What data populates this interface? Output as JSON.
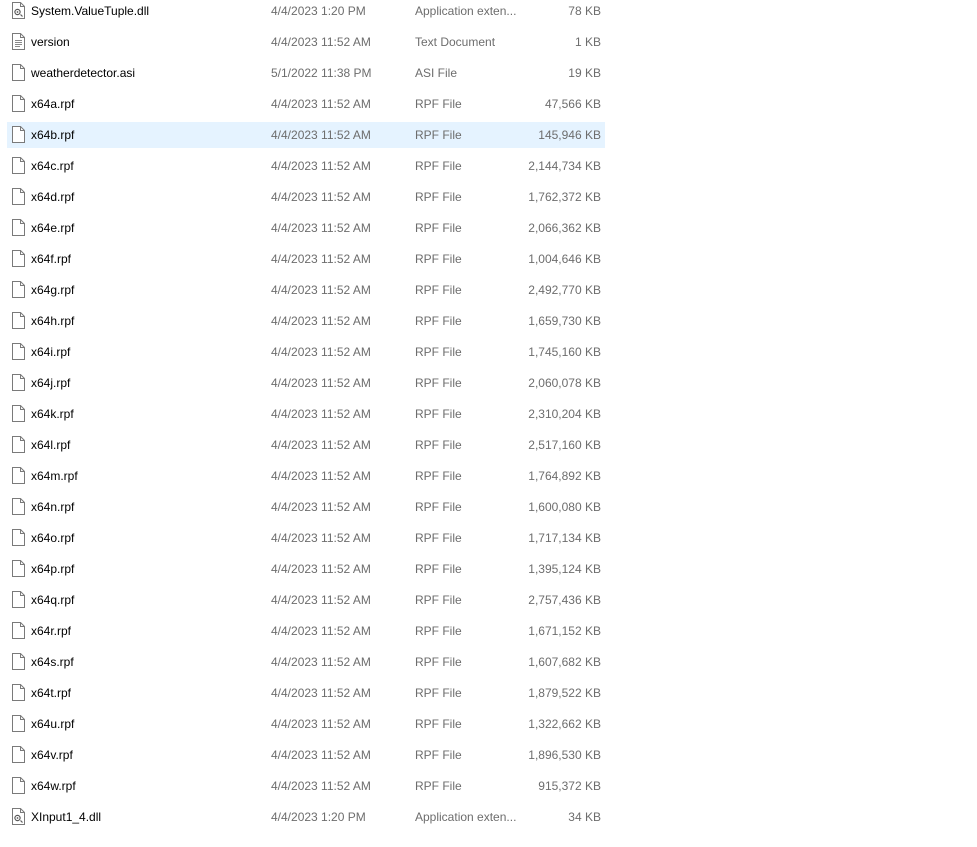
{
  "files": [
    {
      "name": "System.ValueTuple.dll",
      "date": "4/4/2023 1:20 PM",
      "type": "Application exten...",
      "size": "78 KB",
      "icon": "dll-file-icon",
      "selected": false
    },
    {
      "name": "version",
      "date": "4/4/2023 11:52 AM",
      "type": "Text Document",
      "size": "1 KB",
      "icon": "text-file-icon",
      "selected": false
    },
    {
      "name": "weatherdetector.asi",
      "date": "5/1/2022 11:38 PM",
      "type": "ASI File",
      "size": "19 KB",
      "icon": "file-icon",
      "selected": false
    },
    {
      "name": "x64a.rpf",
      "date": "4/4/2023 11:52 AM",
      "type": "RPF File",
      "size": "47,566 KB",
      "icon": "file-icon",
      "selected": false
    },
    {
      "name": "x64b.rpf",
      "date": "4/4/2023 11:52 AM",
      "type": "RPF File",
      "size": "145,946 KB",
      "icon": "file-icon",
      "selected": true
    },
    {
      "name": "x64c.rpf",
      "date": "4/4/2023 11:52 AM",
      "type": "RPF File",
      "size": "2,144,734 KB",
      "icon": "file-icon",
      "selected": false
    },
    {
      "name": "x64d.rpf",
      "date": "4/4/2023 11:52 AM",
      "type": "RPF File",
      "size": "1,762,372 KB",
      "icon": "file-icon",
      "selected": false
    },
    {
      "name": "x64e.rpf",
      "date": "4/4/2023 11:52 AM",
      "type": "RPF File",
      "size": "2,066,362 KB",
      "icon": "file-icon",
      "selected": false
    },
    {
      "name": "x64f.rpf",
      "date": "4/4/2023 11:52 AM",
      "type": "RPF File",
      "size": "1,004,646 KB",
      "icon": "file-icon",
      "selected": false
    },
    {
      "name": "x64g.rpf",
      "date": "4/4/2023 11:52 AM",
      "type": "RPF File",
      "size": "2,492,770 KB",
      "icon": "file-icon",
      "selected": false
    },
    {
      "name": "x64h.rpf",
      "date": "4/4/2023 11:52 AM",
      "type": "RPF File",
      "size": "1,659,730 KB",
      "icon": "file-icon",
      "selected": false
    },
    {
      "name": "x64i.rpf",
      "date": "4/4/2023 11:52 AM",
      "type": "RPF File",
      "size": "1,745,160 KB",
      "icon": "file-icon",
      "selected": false
    },
    {
      "name": "x64j.rpf",
      "date": "4/4/2023 11:52 AM",
      "type": "RPF File",
      "size": "2,060,078 KB",
      "icon": "file-icon",
      "selected": false
    },
    {
      "name": "x64k.rpf",
      "date": "4/4/2023 11:52 AM",
      "type": "RPF File",
      "size": "2,310,204 KB",
      "icon": "file-icon",
      "selected": false
    },
    {
      "name": "x64l.rpf",
      "date": "4/4/2023 11:52 AM",
      "type": "RPF File",
      "size": "2,517,160 KB",
      "icon": "file-icon",
      "selected": false
    },
    {
      "name": "x64m.rpf",
      "date": "4/4/2023 11:52 AM",
      "type": "RPF File",
      "size": "1,764,892 KB",
      "icon": "file-icon",
      "selected": false
    },
    {
      "name": "x64n.rpf",
      "date": "4/4/2023 11:52 AM",
      "type": "RPF File",
      "size": "1,600,080 KB",
      "icon": "file-icon",
      "selected": false
    },
    {
      "name": "x64o.rpf",
      "date": "4/4/2023 11:52 AM",
      "type": "RPF File",
      "size": "1,717,134 KB",
      "icon": "file-icon",
      "selected": false
    },
    {
      "name": "x64p.rpf",
      "date": "4/4/2023 11:52 AM",
      "type": "RPF File",
      "size": "1,395,124 KB",
      "icon": "file-icon",
      "selected": false
    },
    {
      "name": "x64q.rpf",
      "date": "4/4/2023 11:52 AM",
      "type": "RPF File",
      "size": "2,757,436 KB",
      "icon": "file-icon",
      "selected": false
    },
    {
      "name": "x64r.rpf",
      "date": "4/4/2023 11:52 AM",
      "type": "RPF File",
      "size": "1,671,152 KB",
      "icon": "file-icon",
      "selected": false
    },
    {
      "name": "x64s.rpf",
      "date": "4/4/2023 11:52 AM",
      "type": "RPF File",
      "size": "1,607,682 KB",
      "icon": "file-icon",
      "selected": false
    },
    {
      "name": "x64t.rpf",
      "date": "4/4/2023 11:52 AM",
      "type": "RPF File",
      "size": "1,879,522 KB",
      "icon": "file-icon",
      "selected": false
    },
    {
      "name": "x64u.rpf",
      "date": "4/4/2023 11:52 AM",
      "type": "RPF File",
      "size": "1,322,662 KB",
      "icon": "file-icon",
      "selected": false
    },
    {
      "name": "x64v.rpf",
      "date": "4/4/2023 11:52 AM",
      "type": "RPF File",
      "size": "1,896,530 KB",
      "icon": "file-icon",
      "selected": false
    },
    {
      "name": "x64w.rpf",
      "date": "4/4/2023 11:52 AM",
      "type": "RPF File",
      "size": "915,372 KB",
      "icon": "file-icon",
      "selected": false
    },
    {
      "name": "XInput1_4.dll",
      "date": "4/4/2023 1:20 PM",
      "type": "Application exten...",
      "size": "34 KB",
      "icon": "dll-file-icon",
      "selected": false
    }
  ],
  "colors": {
    "selected_row_background": "#e5f3ff",
    "secondary_text": "#6d6d6d",
    "primary_text": "#000000"
  }
}
